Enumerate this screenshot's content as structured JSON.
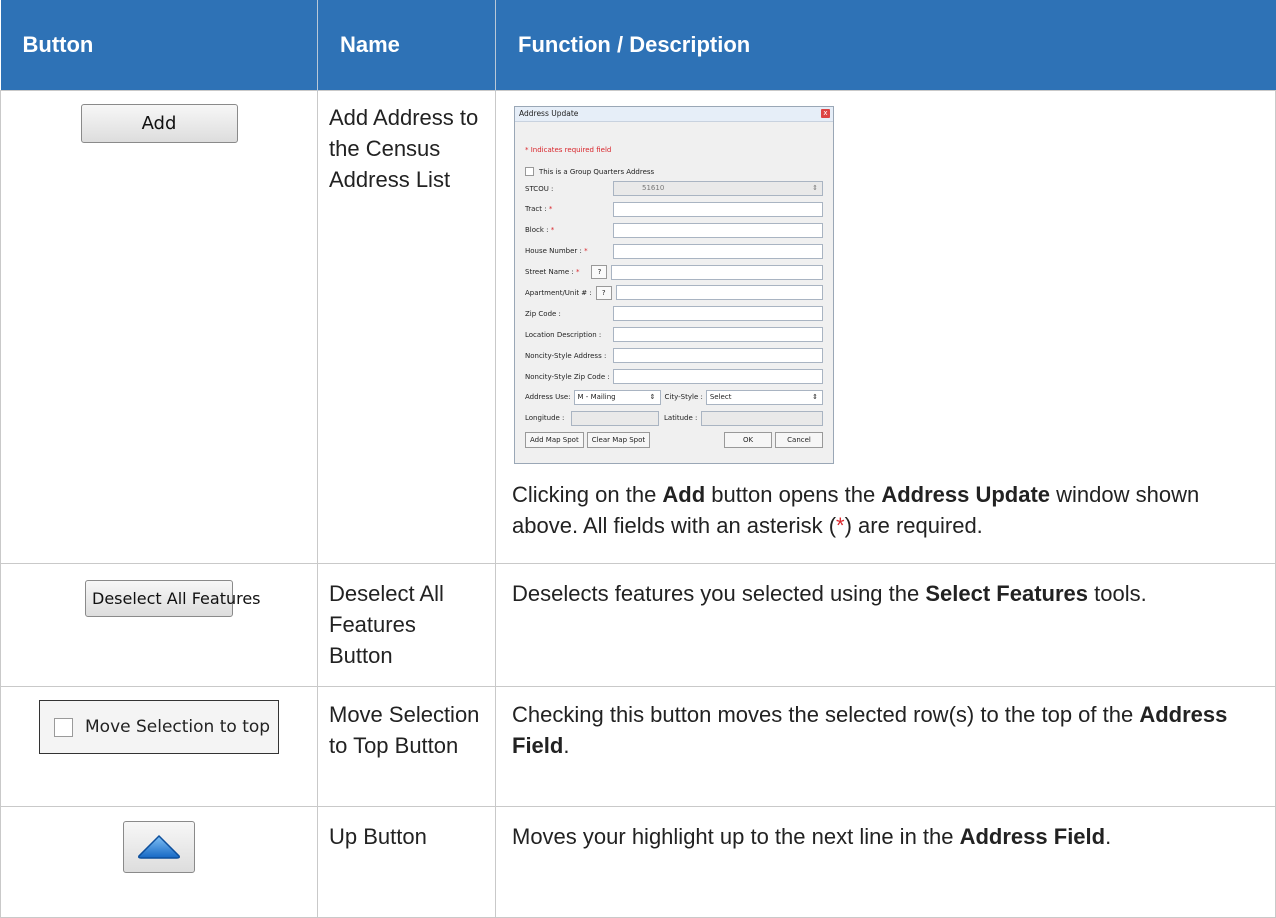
{
  "header": {
    "col_button": "Button",
    "col_name": "Name",
    "col_description": "Function / Description"
  },
  "rows": [
    {
      "button_label": "Add",
      "name": "Add Address to the Census Address List",
      "desc": {
        "p1": "Clicking on the ",
        "b1": "Add",
        "p2": " button opens the ",
        "b2": "Address Update",
        "p3": " window shown above. All fields with an asterisk (",
        "star": "*",
        "p4": ") are required."
      }
    },
    {
      "button_label": "Deselect All Features",
      "name": "Deselect All Features Button",
      "desc": {
        "p1": "Deselects features you selected using the ",
        "b1": "Select Features",
        "p2": " tools."
      }
    },
    {
      "button_label": "Move Selection to top",
      "name": "Move Selection to Top Button",
      "desc": {
        "p1": "Checking this button moves the selected row(s) to the top of the ",
        "b1": "Address Field",
        "p2": "."
      }
    },
    {
      "button_icon": "up-arrow-icon",
      "name": "Up Button",
      "desc": {
        "p1": "Moves your highlight up to the next line in the ",
        "b1": "Address Field",
        "p2": "."
      }
    }
  ],
  "dialog": {
    "title": "Address Update",
    "required_note": "* Indicates required field",
    "group_quarters": "This is a Group Quarters Address",
    "stcou_label": "STCOU :",
    "stcou_value": "51610",
    "tract_label": "Tract : ",
    "block_label": "Block : ",
    "house_label": "House Number : ",
    "street_label": "Street Name : ",
    "apt_label": "Apartment/Unit # : ",
    "zip_label": "Zip Code :",
    "locdesc_label": "Location Description :",
    "noncity_addr_label": "Noncity-Style Address :",
    "noncity_zip_label": "Noncity-Style Zip Code :",
    "address_use_label": "Address Use:",
    "address_use_value": "M - Mailing",
    "city_style_label": "City-Style :",
    "city_style_value": "Select",
    "longitude_label": "Longitude :",
    "latitude_label": "Latitude :",
    "question": "?",
    "star": "*",
    "spin": "⇕",
    "add_map_spot": "Add Map Spot",
    "clear_map_spot": "Clear Map Spot",
    "ok": "OK",
    "cancel": "Cancel",
    "close": "x"
  },
  "colors": {
    "header_bg": "#2e72b6",
    "required_red": "#d9252b",
    "up_arrow": "#1f7fd6"
  }
}
